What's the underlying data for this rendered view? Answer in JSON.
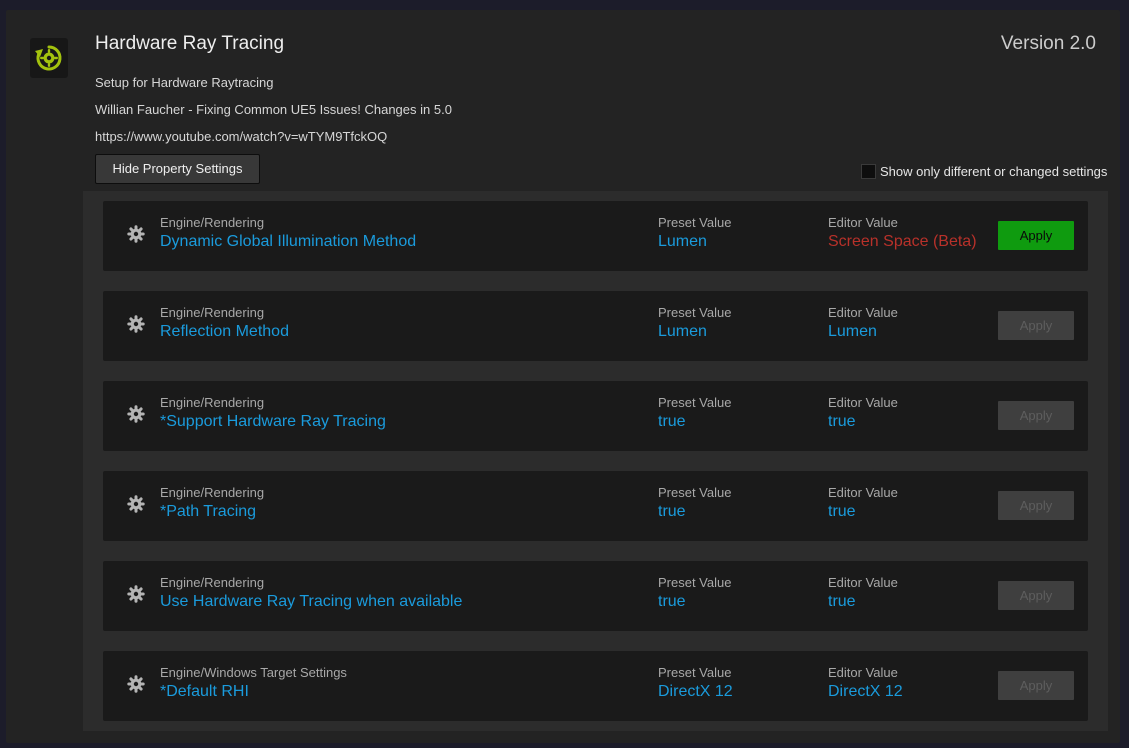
{
  "header": {
    "title": "Hardware Ray Tracing",
    "version": "Version 2.0",
    "description": "Setup for Hardware Raytracing",
    "reference": "Willian Faucher - Fixing Common UE5 Issues! Changes in 5.0",
    "url": "https://www.youtube.com/watch?v=wTYM9TfckOQ",
    "logo_icon": "settings-reset-icon",
    "accent_color": "#a3c20e"
  },
  "toolbar": {
    "hide_label": "Hide Property Settings",
    "filter_label": "Show only different or changed settings",
    "filter_checked": false
  },
  "labels": {
    "preset": "Preset Value",
    "editor": "Editor Value",
    "apply": "Apply"
  },
  "settings": [
    {
      "category": "Engine/Rendering",
      "name": "Dynamic Global Illumination Method",
      "preset": "Lumen",
      "editor": "Screen Space (Beta)",
      "changed": true
    },
    {
      "category": "Engine/Rendering",
      "name": "Reflection Method",
      "preset": "Lumen",
      "editor": "Lumen",
      "changed": false
    },
    {
      "category": "Engine/Rendering",
      "name": "*Support Hardware Ray Tracing",
      "preset": "true",
      "editor": "true",
      "changed": false
    },
    {
      "category": "Engine/Rendering",
      "name": "*Path Tracing",
      "preset": "true",
      "editor": "true",
      "changed": false
    },
    {
      "category": "Engine/Rendering",
      "name": "Use Hardware Ray Tracing when available",
      "preset": "true",
      "editor": "true",
      "changed": false
    },
    {
      "category": "Engine/Windows Target Settings",
      "name": "*Default RHI",
      "preset": "DirectX 12",
      "editor": "DirectX 12",
      "changed": false
    }
  ],
  "colors": {
    "value_blue": "#1a9bdc",
    "diff_red": "#b8312a",
    "apply_green": "#0f9b0f"
  }
}
